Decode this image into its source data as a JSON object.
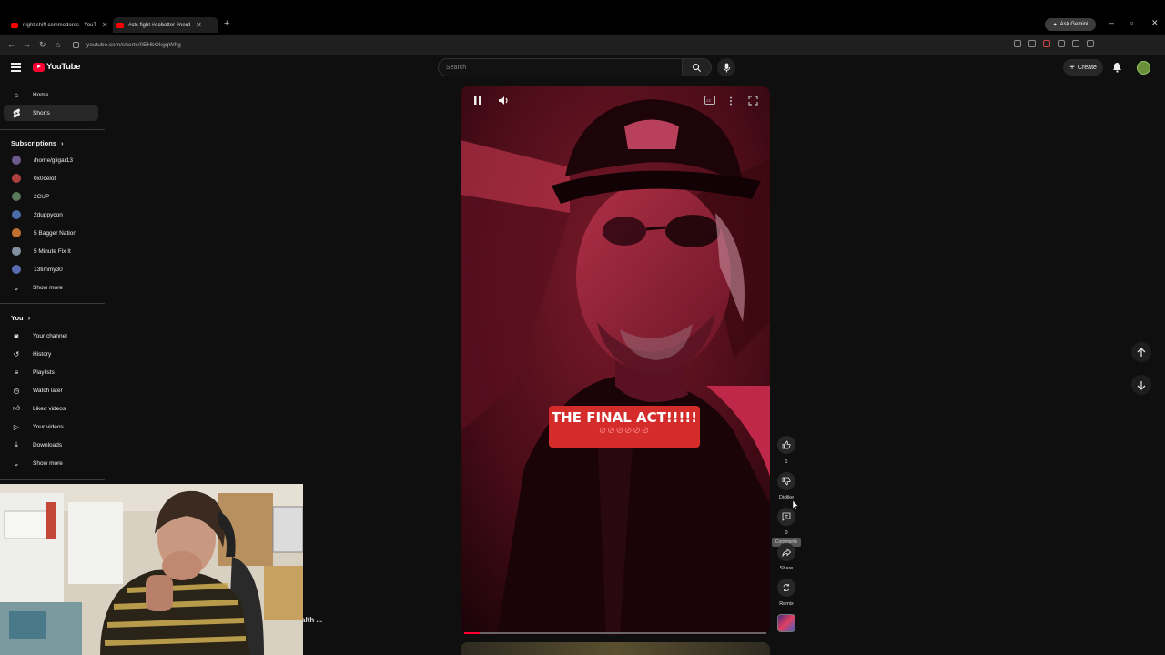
{
  "browser": {
    "tabs": [
      {
        "title": "night shift commodores - YouT"
      },
      {
        "title": "#cts fight #dobetter #nerd"
      }
    ],
    "ask_gemini": "Ask Gemini",
    "url": "youtube.com/shorts/0EHbOkgqWhg"
  },
  "header": {
    "logo_text": "YouTube",
    "search_placeholder": "Search",
    "create_label": "Create"
  },
  "sidebar": {
    "main": [
      {
        "label": "Home",
        "icon": "home-icon"
      },
      {
        "label": "Shorts",
        "icon": "shorts-icon",
        "active": true
      }
    ],
    "subscriptions_heading": "Subscriptions",
    "subscriptions": [
      {
        "label": "/home/gligar13",
        "color": "#6b5a8c"
      },
      {
        "label": "0x0celot",
        "color": "#b04040"
      },
      {
        "label": "2CUP",
        "color": "#5a7a5a"
      },
      {
        "label": "2duppycon",
        "color": "#4a6aa8"
      },
      {
        "label": "5 Bagger Nation",
        "color": "#c07030"
      },
      {
        "label": "5 Minute Fix It",
        "color": "#8090a0"
      },
      {
        "label": "13timmy30",
        "color": "#5a6ab0"
      }
    ],
    "show_more": "Show more",
    "you_heading": "You",
    "you_items": [
      {
        "label": "Your channel",
        "icon": "channel-icon"
      },
      {
        "label": "History",
        "icon": "history-icon"
      },
      {
        "label": "Playlists",
        "icon": "playlists-icon"
      },
      {
        "label": "Watch later",
        "icon": "watch-later-icon"
      },
      {
        "label": "Liked videos",
        "icon": "thumb-up-icon"
      },
      {
        "label": "Your videos",
        "icon": "your-videos-icon"
      },
      {
        "label": "Downloads",
        "icon": "download-icon"
      },
      {
        "label": "Show more",
        "icon": "chevron-down-icon"
      }
    ]
  },
  "short": {
    "caption_line1": "THE FINAL ACT!!!!!",
    "caption_line2": "⊘⊘⊘⊘⊘⊘",
    "progress_fraction": 0.05,
    "actions": {
      "like_count": "1",
      "dislike_label": "Dislike",
      "comments_count": "0",
      "comments_tooltip": "Comments",
      "share_label": "Share",
      "remix_label": "Remix"
    }
  },
  "overlay": {
    "behind_text": "alth ..."
  }
}
